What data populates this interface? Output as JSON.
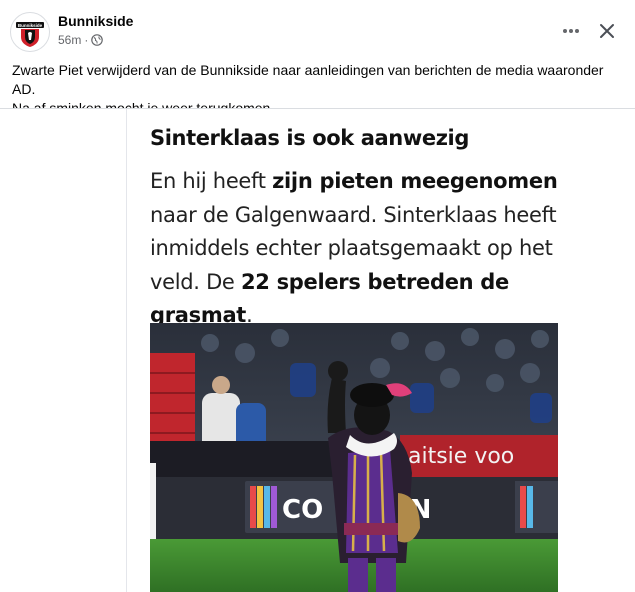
{
  "post": {
    "author": "Bunnikside",
    "time": "56m",
    "separator": "·",
    "privacy_icon": "globe-icon",
    "avatar_text": "Bunnikside",
    "caption_line1": "Zwarte Piet verwijderd van de Bunnikside naar aanleidingen van berichten de media waaronder AD.",
    "caption_line2": "Na af sminken mocht ie weer terugkomen.",
    "actions": {
      "more_icon": "more-horizontal-icon",
      "close_icon": "close-icon"
    }
  },
  "article": {
    "heading": "Sinterklaas is ook aanwezig",
    "body": {
      "p1": "En hij heeft ",
      "b1": "zijn pieten meegenomen",
      "p2": " naar de Galgenwaard. Sinterklaas heeft inmiddels echter plaatsgemaakt op het veld. De ",
      "b2": "22 spelers betreden de grasmat",
      "p3": "."
    },
    "photo": {
      "board_text_right": "aitsie voo",
      "board_text_center": "CO",
      "board_text_center2": "IN"
    }
  },
  "colors": {
    "text_primary": "#050505",
    "text_secondary": "#65676b",
    "divider": "#dadde1",
    "costume_purple": "#5b2d8e",
    "stadium_red": "#c0262d",
    "pitch_green": "#3f8a2f"
  }
}
